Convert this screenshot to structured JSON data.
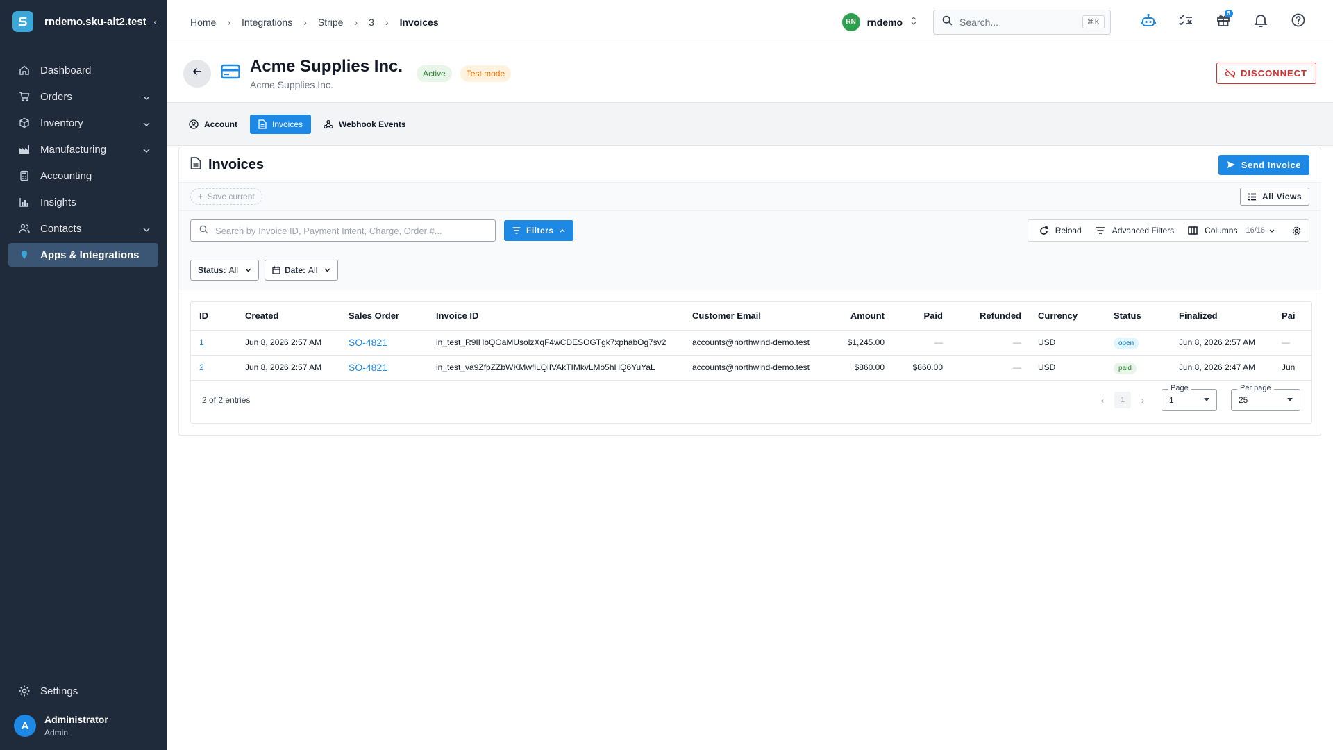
{
  "org_name": "rndemo.sku-alt2.test",
  "sidebar": {
    "items": [
      {
        "label": "Dashboard",
        "icon": "home-icon"
      },
      {
        "label": "Orders",
        "icon": "cart-icon"
      },
      {
        "label": "Inventory",
        "icon": "box-icon"
      },
      {
        "label": "Manufacturing",
        "icon": "factory-icon"
      },
      {
        "label": "Accounting",
        "icon": "calculator-icon"
      },
      {
        "label": "Insights",
        "icon": "bar-chart-icon"
      },
      {
        "label": "Contacts",
        "icon": "contacts-icon"
      },
      {
        "label": "Apps & Integrations",
        "icon": "apps-icon"
      }
    ],
    "settings_label": "Settings",
    "user": {
      "initial": "A",
      "name": "Administrator",
      "role": "Admin"
    }
  },
  "breadcrumbs": [
    "Home",
    "Integrations",
    "Stripe",
    "3",
    "Invoices"
  ],
  "workspace": {
    "initials": "RN",
    "name": "rndemo"
  },
  "search": {
    "placeholder": "Search...",
    "shortcut": "⌘K"
  },
  "notifications_badge": "5",
  "header": {
    "title": "Acme Supplies Inc.",
    "subtitle": "Acme Supplies Inc.",
    "status_active": "Active",
    "status_mode": "Test mode",
    "disconnect_label": "DISCONNECT"
  },
  "tabs": [
    "Account",
    "Invoices",
    "Webhook Events"
  ],
  "panel": {
    "title": "Invoices",
    "send_label": "Send Invoice",
    "save_current": "Save current",
    "all_views": "All Views",
    "search_placeholder": "Search by Invoice ID, Payment Intent, Charge, Order #...",
    "filters_label": "Filters",
    "reload_label": "Reload",
    "advanced_filters_label": "Advanced Filters",
    "columns_label": "Columns",
    "columns_count": "16/16",
    "status_filter_key": "Status:",
    "status_filter_value": "All",
    "date_filter_key": "Date:",
    "date_filter_value": "All"
  },
  "table": {
    "columns": [
      "ID",
      "Created",
      "Sales Order",
      "Invoice ID",
      "Customer Email",
      "Amount",
      "Paid",
      "Refunded",
      "Currency",
      "Status",
      "Finalized",
      "Pai"
    ],
    "rows": [
      {
        "id": "1",
        "created": "Jun 8, 2026 2:57 AM",
        "sales_order": "SO-4821",
        "invoice_id": "in_test_R9IHbQOaMUsolzXqF4wCDESOGTgk7xphabOg7sv2",
        "email": "accounts@northwind-demo.test",
        "amount": "$1,245.00",
        "paid": "—",
        "refunded": "—",
        "currency": "USD",
        "status": "open",
        "finalized": "Jun 8, 2026 2:57 AM",
        "paid_at": "—"
      },
      {
        "id": "2",
        "created": "Jun 8, 2026 2:57 AM",
        "sales_order": "SO-4821",
        "invoice_id": "in_test_va9ZfpZZbWKMwflLQlIVAkTIMkvLMo5hHQ6YuYaL",
        "email": "accounts@northwind-demo.test",
        "amount": "$860.00",
        "paid": "$860.00",
        "refunded": "—",
        "currency": "USD",
        "status": "paid",
        "finalized": "Jun 8, 2026 2:47 AM",
        "paid_at": "Jun"
      }
    ]
  },
  "footer": {
    "entries": "2 of 2 entries",
    "current_page": "1",
    "page_label": "Page",
    "page_value": "1",
    "per_page_label": "Per page",
    "per_page_value": "25"
  },
  "colors": {
    "sidebar_bg": "#1f2a3a",
    "accent": "#1e88e5",
    "danger": "#d32f2f"
  }
}
